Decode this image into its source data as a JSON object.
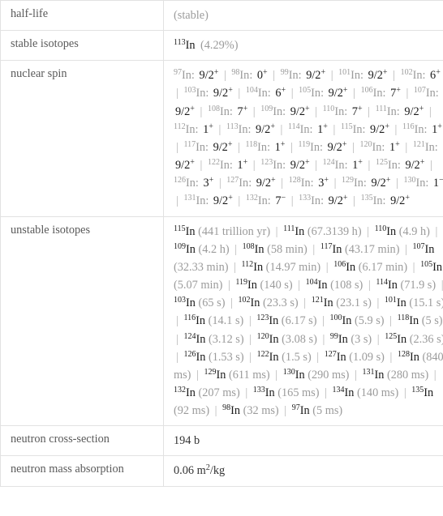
{
  "rows": [
    {
      "label": "half-life",
      "value_text": "(stable)",
      "style": "muted"
    },
    {
      "label": "stable isotopes"
    },
    {
      "label": "nuclear spin"
    },
    {
      "label": "unstable isotopes"
    },
    {
      "label": "neutron cross-section",
      "value_text": "194 b"
    },
    {
      "label": "neutron mass absorption"
    }
  ],
  "half_life": {
    "label": "half-life",
    "value": "(stable)"
  },
  "stable_isotopes": {
    "label": "stable isotopes",
    "items": [
      {
        "mass": "113",
        "symbol": "In",
        "detail": "(4.29%)"
      }
    ]
  },
  "nuclear_spin": {
    "label": "nuclear spin",
    "items": [
      {
        "mass": "97",
        "symbol": "In:",
        "spin": "9/2",
        "sign": "+"
      },
      {
        "mass": "98",
        "symbol": "In:",
        "spin": "0",
        "sign": "+"
      },
      {
        "mass": "99",
        "symbol": "In:",
        "spin": "9/2",
        "sign": "+"
      },
      {
        "mass": "101",
        "symbol": "In:",
        "spin": "9/2",
        "sign": "+"
      },
      {
        "mass": "102",
        "symbol": "In:",
        "spin": "6",
        "sign": "+"
      },
      {
        "mass": "103",
        "symbol": "In:",
        "spin": "9/2",
        "sign": "+"
      },
      {
        "mass": "104",
        "symbol": "In:",
        "spin": "6",
        "sign": "+"
      },
      {
        "mass": "105",
        "symbol": "In:",
        "spin": "9/2",
        "sign": "+"
      },
      {
        "mass": "106",
        "symbol": "In:",
        "spin": "7",
        "sign": "+"
      },
      {
        "mass": "107",
        "symbol": "In:",
        "spin": "9/2",
        "sign": "+"
      },
      {
        "mass": "108",
        "symbol": "In:",
        "spin": "7",
        "sign": "+"
      },
      {
        "mass": "109",
        "symbol": "In:",
        "spin": "9/2",
        "sign": "+"
      },
      {
        "mass": "110",
        "symbol": "In:",
        "spin": "7",
        "sign": "+"
      },
      {
        "mass": "111",
        "symbol": "In:",
        "spin": "9/2",
        "sign": "+"
      },
      {
        "mass": "112",
        "symbol": "In:",
        "spin": "1",
        "sign": "+"
      },
      {
        "mass": "113",
        "symbol": "In:",
        "spin": "9/2",
        "sign": "+"
      },
      {
        "mass": "114",
        "symbol": "In:",
        "spin": "1",
        "sign": "+"
      },
      {
        "mass": "115",
        "symbol": "In:",
        "spin": "9/2",
        "sign": "+"
      },
      {
        "mass": "116",
        "symbol": "In:",
        "spin": "1",
        "sign": "+"
      },
      {
        "mass": "117",
        "symbol": "In:",
        "spin": "9/2",
        "sign": "+"
      },
      {
        "mass": "118",
        "symbol": "In:",
        "spin": "1",
        "sign": "+"
      },
      {
        "mass": "119",
        "symbol": "In:",
        "spin": "9/2",
        "sign": "+"
      },
      {
        "mass": "120",
        "symbol": "In:",
        "spin": "1",
        "sign": "+"
      },
      {
        "mass": "121",
        "symbol": "In:",
        "spin": "9/2",
        "sign": "+"
      },
      {
        "mass": "122",
        "symbol": "In:",
        "spin": "1",
        "sign": "+"
      },
      {
        "mass": "123",
        "symbol": "In:",
        "spin": "9/2",
        "sign": "+"
      },
      {
        "mass": "124",
        "symbol": "In:",
        "spin": "1",
        "sign": "+"
      },
      {
        "mass": "125",
        "symbol": "In:",
        "spin": "9/2",
        "sign": "+"
      },
      {
        "mass": "126",
        "symbol": "In:",
        "spin": "3",
        "sign": "+"
      },
      {
        "mass": "127",
        "symbol": "In:",
        "spin": "9/2",
        "sign": "+"
      },
      {
        "mass": "128",
        "symbol": "In:",
        "spin": "3",
        "sign": "+"
      },
      {
        "mass": "129",
        "symbol": "In:",
        "spin": "9/2",
        "sign": "+"
      },
      {
        "mass": "130",
        "symbol": "In:",
        "spin": "1",
        "sign": "−"
      },
      {
        "mass": "131",
        "symbol": "In:",
        "spin": "9/2",
        "sign": "+"
      },
      {
        "mass": "132",
        "symbol": "In:",
        "spin": "7",
        "sign": "−"
      },
      {
        "mass": "133",
        "symbol": "In:",
        "spin": "9/2",
        "sign": "+"
      },
      {
        "mass": "135",
        "symbol": "In:",
        "spin": "9/2",
        "sign": "+"
      }
    ]
  },
  "unstable_isotopes": {
    "label": "unstable isotopes",
    "items": [
      {
        "mass": "115",
        "symbol": "In",
        "detail": "(441 trillion yr)"
      },
      {
        "mass": "111",
        "symbol": "In",
        "detail": "(67.3139 h)"
      },
      {
        "mass": "110",
        "symbol": "In",
        "detail": "(4.9 h)"
      },
      {
        "mass": "109",
        "symbol": "In",
        "detail": "(4.2 h)"
      },
      {
        "mass": "108",
        "symbol": "In",
        "detail": "(58 min)"
      },
      {
        "mass": "117",
        "symbol": "In",
        "detail": "(43.17 min)"
      },
      {
        "mass": "107",
        "symbol": "In",
        "detail": "(32.33 min)"
      },
      {
        "mass": "112",
        "symbol": "In",
        "detail": "(14.97 min)"
      },
      {
        "mass": "106",
        "symbol": "In",
        "detail": "(6.17 min)"
      },
      {
        "mass": "105",
        "symbol": "In",
        "detail": "(5.07 min)"
      },
      {
        "mass": "119",
        "symbol": "In",
        "detail": "(140 s)"
      },
      {
        "mass": "104",
        "symbol": "In",
        "detail": "(108 s)"
      },
      {
        "mass": "114",
        "symbol": "In",
        "detail": "(71.9 s)"
      },
      {
        "mass": "103",
        "symbol": "In",
        "detail": "(65 s)"
      },
      {
        "mass": "102",
        "symbol": "In",
        "detail": "(23.3 s)"
      },
      {
        "mass": "121",
        "symbol": "In",
        "detail": "(23.1 s)"
      },
      {
        "mass": "101",
        "symbol": "In",
        "detail": "(15.1 s)"
      },
      {
        "mass": "116",
        "symbol": "In",
        "detail": "(14.1 s)"
      },
      {
        "mass": "123",
        "symbol": "In",
        "detail": "(6.17 s)"
      },
      {
        "mass": "100",
        "symbol": "In",
        "detail": "(5.9 s)"
      },
      {
        "mass": "118",
        "symbol": "In",
        "detail": "(5 s)"
      },
      {
        "mass": "124",
        "symbol": "In",
        "detail": "(3.12 s)"
      },
      {
        "mass": "120",
        "symbol": "In",
        "detail": "(3.08 s)"
      },
      {
        "mass": "99",
        "symbol": "In",
        "detail": "(3 s)"
      },
      {
        "mass": "125",
        "symbol": "In",
        "detail": "(2.36 s)"
      },
      {
        "mass": "126",
        "symbol": "In",
        "detail": "(1.53 s)"
      },
      {
        "mass": "122",
        "symbol": "In",
        "detail": "(1.5 s)"
      },
      {
        "mass": "127",
        "symbol": "In",
        "detail": "(1.09 s)"
      },
      {
        "mass": "128",
        "symbol": "In",
        "detail": "(840 ms)"
      },
      {
        "mass": "129",
        "symbol": "In",
        "detail": "(611 ms)"
      },
      {
        "mass": "130",
        "symbol": "In",
        "detail": "(290 ms)"
      },
      {
        "mass": "131",
        "symbol": "In",
        "detail": "(280 ms)"
      },
      {
        "mass": "132",
        "symbol": "In",
        "detail": "(207 ms)"
      },
      {
        "mass": "133",
        "symbol": "In",
        "detail": "(165 ms)"
      },
      {
        "mass": "134",
        "symbol": "In",
        "detail": "(140 ms)"
      },
      {
        "mass": "135",
        "symbol": "In",
        "detail": "(92 ms)"
      },
      {
        "mass": "98",
        "symbol": "In",
        "detail": "(32 ms)"
      },
      {
        "mass": "97",
        "symbol": "In",
        "detail": "(5 ms)"
      }
    ]
  },
  "neutron_cross_section": {
    "label": "neutron cross-section",
    "value": "194 b"
  },
  "neutron_mass_absorption": {
    "label": "neutron mass absorption",
    "value_number": "0.06",
    "value_unit_base": "m",
    "value_unit_sup": "2",
    "value_unit_tail": "/kg"
  },
  "colors": {
    "border": "#e2e2e2",
    "label_text": "#5a5a5a",
    "value_text": "#1b1b1b",
    "muted_text": "#9b9b9b",
    "separator": "#b5b5b5",
    "background": "#ffffff"
  }
}
